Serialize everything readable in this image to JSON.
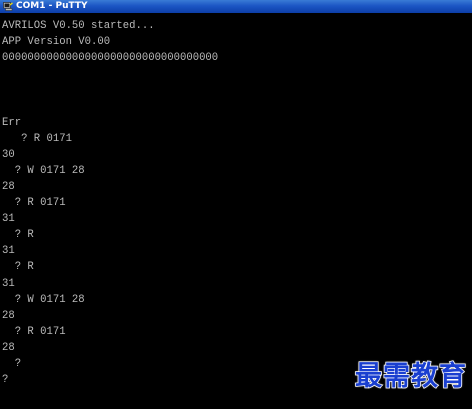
{
  "window": {
    "title": "COM1 - PuTTY"
  },
  "terminal": {
    "lines": [
      "AVRILOS V0.50 started...",
      "APP Version V0.00",
      "0000000000000000000000000000000000",
      "",
      "",
      "",
      "Err",
      "   ? R 0171",
      "30",
      "  ? W 0171 28",
      "28",
      "  ? R 0171",
      "31",
      "  ? R",
      "31",
      "  ? R",
      "31",
      "  ? W 0171 28",
      "28",
      "  ? R 0171",
      "28",
      "  ?",
      "?"
    ]
  },
  "watermark": {
    "text": "最需教育"
  },
  "colors": {
    "background": "#000000",
    "text": "#bbbbbb",
    "titlebar": "#1c56c4",
    "watermark": "#1a3fd0"
  },
  "icons": {
    "app_icon": "putty-terminal-icon"
  }
}
